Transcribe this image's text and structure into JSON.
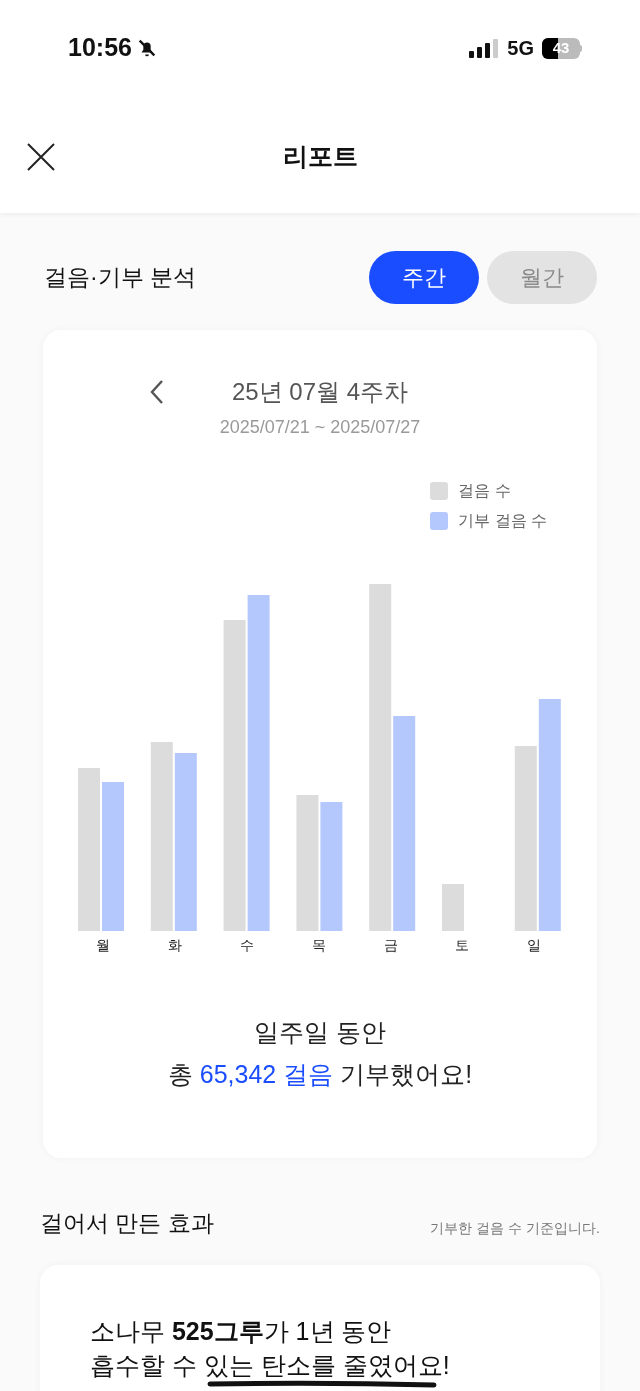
{
  "status_bar": {
    "time": "10:56",
    "network": "5G",
    "battery": "43"
  },
  "header": {
    "title": "리포트"
  },
  "analysis": {
    "title": "걸음·기부 분석",
    "tabs": [
      {
        "label": "주간",
        "selected": true
      },
      {
        "label": "월간",
        "selected": false
      }
    ],
    "period": {
      "title": "25년 07월 4주차",
      "range": "2025/07/21 ~ 2025/07/27"
    },
    "legend": [
      {
        "label": "걸음 수",
        "color": "#dcdcdc"
      },
      {
        "label": "기부 걸음 수",
        "color": "#b5c8fd"
      }
    ],
    "days": [
      "월",
      "화",
      "수",
      "목",
      "금",
      "토",
      "일"
    ],
    "summary": {
      "line1": "일주일 동안",
      "prefix": "총",
      "highlight": "65,342 걸음",
      "suffix": "기부했어요!"
    }
  },
  "effect": {
    "title": "걸어서 만든 효과",
    "note": "기부한 걸음 수 기준입니다.",
    "line1": "소나무 **525그루**가 1년 동안",
    "line2": "흡수할 수 있는 탄소를 줄였어요!"
  }
}
